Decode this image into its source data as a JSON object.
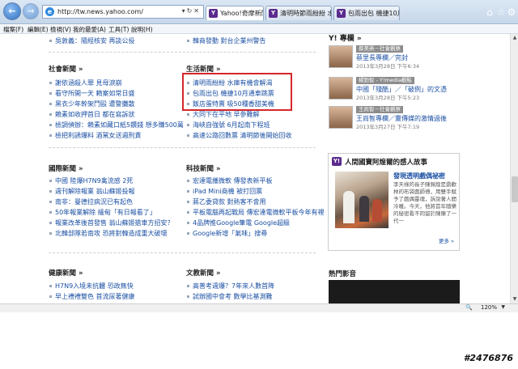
{
  "browser": {
    "url": "http://tw.news.yahoo.com/",
    "tabs": [
      {
        "title": "Yahoo!奇摩新聞",
        "active": true
      },
      {
        "title": "清明時節雨紛紛 水庫...",
        "active": false
      },
      {
        "title": "包雨出包 機捷10月...",
        "active": false
      }
    ],
    "menu": [
      "檔案(F)",
      "編輯(E)",
      "檢視(V)",
      "我的最愛(A)",
      "工具(T)",
      "說明(H)"
    ],
    "zoom": "120%"
  },
  "top_items": {
    "left": "吳敦義：隨經核安 再談公投",
    "mid": "韓商發動 對台企業州警告"
  },
  "social": {
    "title": "社會新聞 »",
    "items": [
      "謝依涵殺人罪 見母淚崩",
      "看守所開一天 賴案如常日盛",
      "黑衣少年幹架鬥毆 遭警攤散",
      "賴素如收押首日 都在寫訴狀",
      "檢調偵辦：賴素如藏口紙5鑽錢 想多賺500萬",
      "檢把利誘爆料 酒駕女送週刑責"
    ]
  },
  "life": {
    "title": "生活新聞 »",
    "items": [
      "清明雨紛紛 水庫有機會解渴",
      "包雨出包 機捷10月通車跳票",
      "飯店蛋特賣 吸50種香甜美機",
      "大同下在平地 早參難解",
      "海峽自強號 6月起南下程班",
      "高速公路回數票 清明節後開始回收"
    ]
  },
  "world": {
    "title": "國際新聞 »",
    "items": [
      "中國 陸爆H7N9禽流感 2死",
      "週刊解除報業 翁山蘇姬投報",
      "南非：曼德拉病況已有起色",
      "50年報業解除 緬甸「有日報看了」",
      "報業改革後首發售 翁山蘇姬搶車方招安？",
      "北韓部隊若南攻 恐將對韓造成重大破壞"
    ]
  },
  "tech": {
    "title": "科技新聞 »",
    "items": [
      "宏達電攜微軟 傳發表新平板",
      "iPad Mini商機 被打回票",
      "蔣乙委貸款 對熱客不會用",
      "平板電腦再起戰局 傳宏達電微軟平板今年有裡",
      "4品牌推Google筆電 Google超級",
      "Google新增「氣味」搜尋"
    ]
  },
  "health": {
    "title": "健康新聞 »",
    "items": [
      "H7N9入境未抗體 恐政無快",
      "早上禮禮雙色 首流尿著健康"
    ]
  },
  "culture": {
    "title": "文教新聞 »",
    "items": [
      "高普考週爆？7年來人數首降",
      "試辦國中會考 數學比基測難"
    ]
  },
  "sidebar": {
    "columns_title": "Y! 專欄 »",
    "columns": [
      {
        "tag": "蔡美燕－社會觀察",
        "headline": "蔡里長專欄／完封",
        "date": "2013年3月28日 下午6:34"
      },
      {
        "tag": "楊勁智 - Y!media觀點",
        "headline": "中國「殘酷」／「破例」的文憑",
        "date": "2013年3月28日 下午5:23"
      },
      {
        "tag": "王尚智－社會觀察",
        "headline": "王尚智專欄／靈傳媒的激情過後",
        "date": "2013年3月27日 下午7:19"
      }
    ],
    "feature": {
      "title": "人間國寶阿煌爾的感人故事",
      "headline": "發現透明戲偶祕密",
      "body": "李天祿的長子陳錫煌是鼎歡林的布袋戲師傅，用雙手賦予了戲偶靈魂，訴說著人間冷暖。今天，他將首年隨樂的秘密看不同留於陳陳了一代一",
      "more": "更多 »"
    },
    "video_title": "熱門影音"
  },
  "watermark": "#2476876"
}
